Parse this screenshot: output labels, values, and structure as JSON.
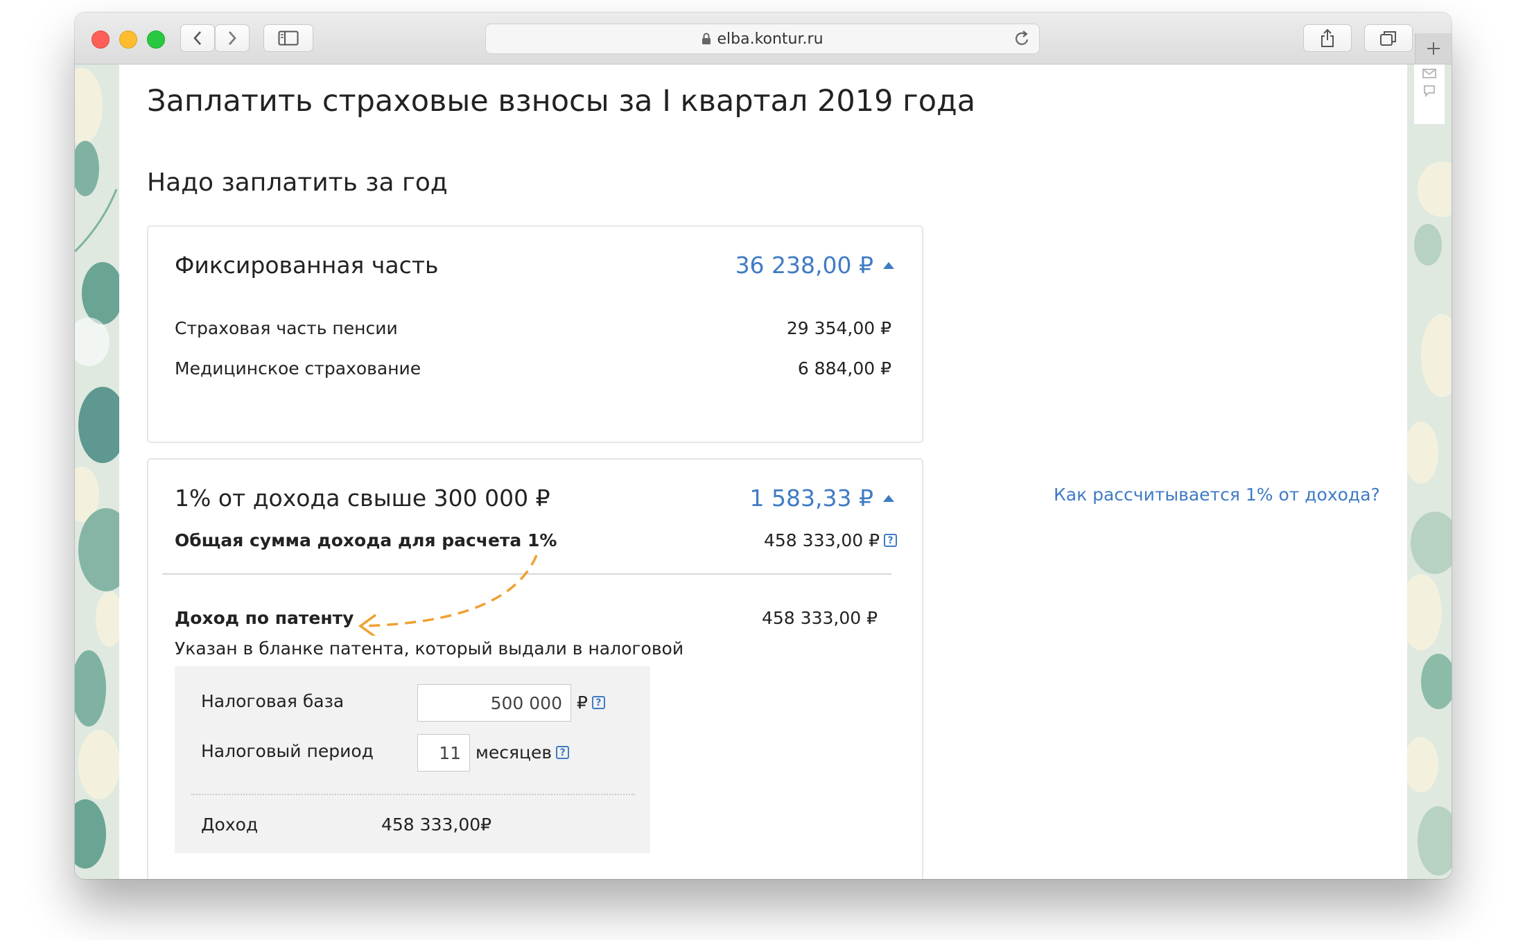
{
  "browser": {
    "url": "elba.kontur.ru"
  },
  "page": {
    "title": "Заплатить страховые взносы за I квартал 2019 года",
    "subtitle": "Надо заплатить за год",
    "help_link": "Как рассчитывается 1% от дохода?"
  },
  "fixed": {
    "title": "Фиксированная часть",
    "amount": "36 238,00 ₽",
    "items": [
      {
        "label": "Страховая часть пенсии",
        "value": "29 354,00 ₽"
      },
      {
        "label": "Медицинское страхование",
        "value": "6 884,00 ₽"
      }
    ]
  },
  "percent": {
    "title": "1% от дохода свыше 300 000 ₽",
    "amount": "1 583,33 ₽",
    "total_label": "Общая сумма дохода для расчета 1%",
    "total_value": "458 333,00 ₽",
    "patent_label": "Доход по патенту",
    "patent_value": "458 333,00 ₽",
    "patent_hint": "Указан в бланке патента, который выдали в налоговой",
    "form": {
      "base_label": "Налоговая база",
      "base_value": "500 000",
      "base_unit": "₽",
      "period_label": "Налоговый период",
      "period_value": "11",
      "period_unit": "месяцев",
      "income_label": "Доход",
      "income_value": "458 333,00₽"
    }
  },
  "colors": {
    "accent": "#3f7bc4",
    "arrow": "#f0a030",
    "background_leaves": "#dfe9e0"
  },
  "icons": [
    "back-icon",
    "forward-icon",
    "sidebar-icon",
    "lock-icon",
    "reload-icon",
    "share-icon",
    "tabs-icon",
    "plus-icon",
    "help-icon"
  ]
}
